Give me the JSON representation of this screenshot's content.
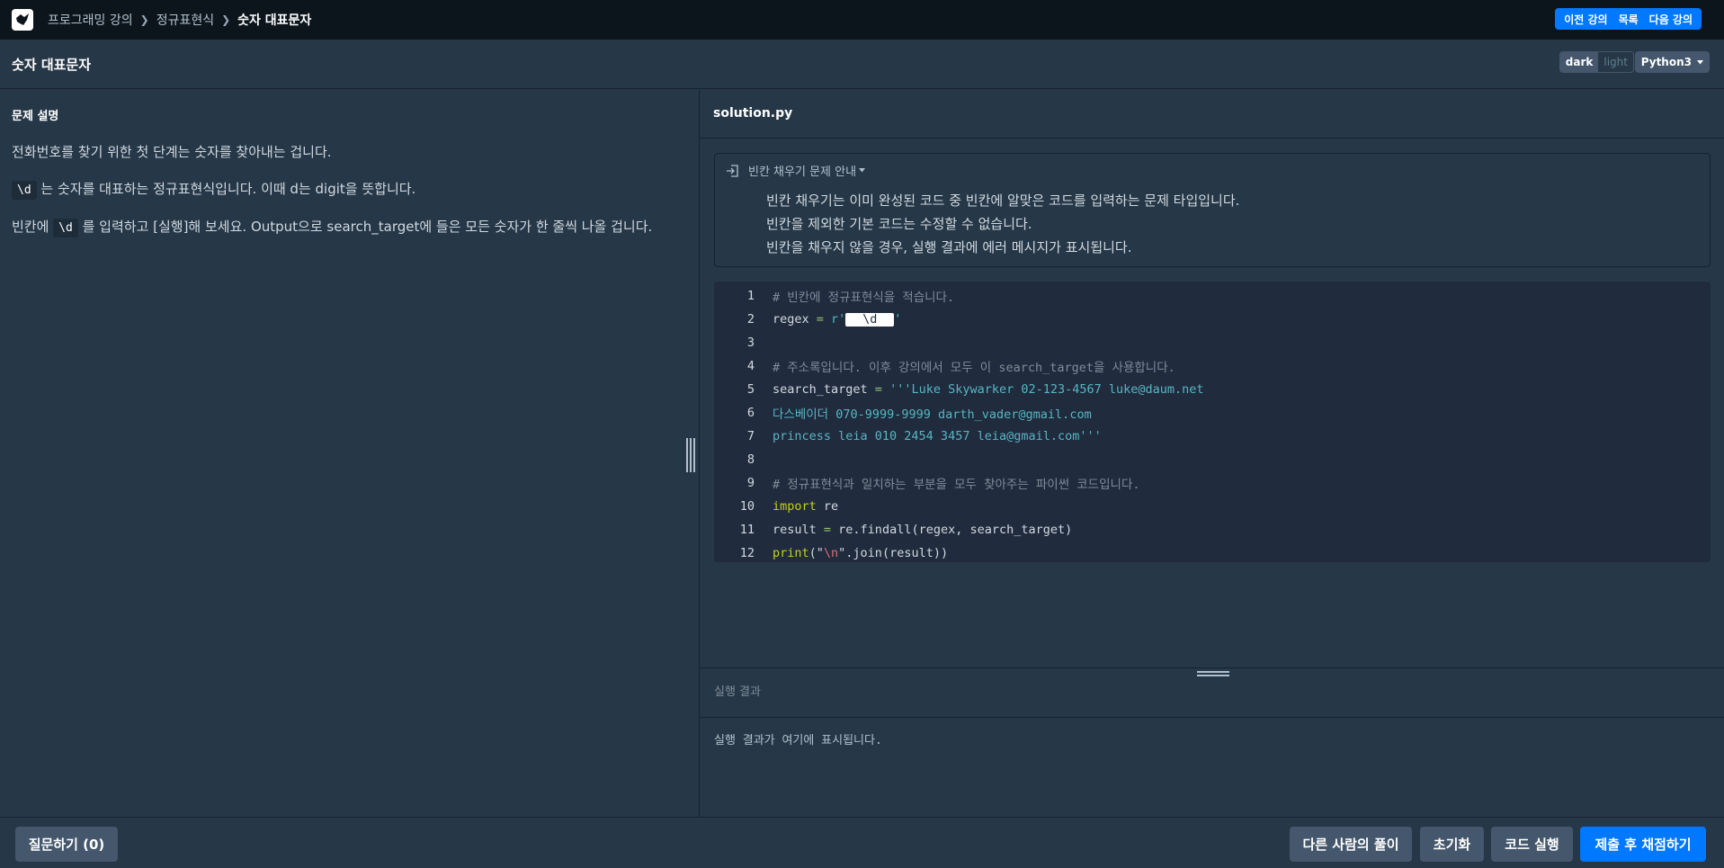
{
  "header": {
    "breadcrumb": [
      "프로그래밍 강의",
      "정규표현식",
      "숫자 대표문자"
    ],
    "nav": {
      "prev": "이전 강의",
      "list": "목록",
      "next": "다음 강의"
    }
  },
  "title_bar": {
    "title": "숫자 대표문자",
    "theme_dark": "dark",
    "theme_light": "light",
    "language": "Python3"
  },
  "problem": {
    "heading": "문제 설명",
    "p1": "전화번호를 찾기 위한 첫 단계는 숫자를 찾아내는 겁니다.",
    "p2_code": "\\d",
    "p2_text": " 는 숫자를 대표하는 정규표현식입니다. 이때 d는 digit을 뜻합니다.",
    "p3_pre": "빈칸에 ",
    "p3_code": "\\d",
    "p3_text": " 를 입력하고 [실행]해 보세요. Output으로 search_target에 들은 모든 숫자가 한 줄씩 나올 겁니다."
  },
  "editor": {
    "filename": "solution.py",
    "hint_title": "빈칸 채우기 문제 안내",
    "hint_lines": [
      "빈칸 채우기는 이미 완성된 코드 중 빈칸에 알맞은 코드를 입력하는 문제 타입입니다.",
      "빈칸을 제외한 기본 코드는 수정할 수 없습니다.",
      "빈칸을 채우지 않을 경우, 실행 결과에 에러 메시지가 표시됩니다."
    ],
    "line_numbers": [
      "1",
      "2",
      "3",
      "4",
      "5",
      "6",
      "7",
      "8",
      "9",
      "10",
      "11",
      "12"
    ],
    "code": {
      "l1": "# 빈칸에 정규표현식을 적습니다.",
      "l2_a": "regex",
      "l2_op": " = ",
      "l2_pre": "r'",
      "l2_blank": "\\d",
      "l2_post": "'",
      "l4": "# 주소록입니다. 이후 강의에서 모두 이 search_target을 사용합니다.",
      "l5_a": "search_target",
      "l5_op": " = ",
      "l5_str": "'''Luke Skywarker 02-123-4567 luke@daum.net",
      "l6": "다스베이더 070-9999-9999 darth_vader@gmail.com",
      "l7": "princess leia 010 2454 3457 leia@gmail.com'''",
      "l9": "# 정규표현식과 일치하는 부분을 모두 찾아주는 파이썬 코드입니다.",
      "l10_kw": "import",
      "l10_rest": " re",
      "l11_a": "result",
      "l11_op": " = ",
      "l11_rest": "re.findall(regex, search_target)",
      "l12_kw": "print",
      "l12_a": "(\"",
      "l12_esc": "\\n",
      "l12_b": "\".join(result))"
    }
  },
  "result": {
    "label": "실행 결과",
    "placeholder": "실행 결과가 여기에 표시됩니다."
  },
  "footer": {
    "ask": "질문하기 (0)",
    "others": "다른 사람의 풀이",
    "reset": "초기화",
    "run": "코드 실행",
    "submit": "제출 후 채점하기"
  }
}
